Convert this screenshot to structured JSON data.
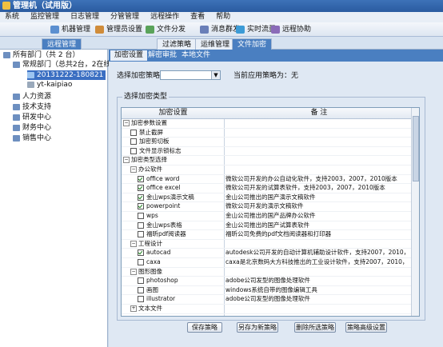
{
  "window": {
    "title": "管理机（试用版）"
  },
  "menu": [
    "系统",
    "监控管理",
    "日志管理",
    "分管管理",
    "远程操作",
    "查看",
    "帮助"
  ],
  "toolbar": [
    "机器管理",
    "管理员设置",
    "文件分发",
    "消息群发",
    "实时流量",
    "远程协助"
  ],
  "top_tabs": [
    "远程管理",
    "过滤策略",
    "运维管理",
    "文件加密"
  ],
  "tree": {
    "root": "所有部门（共 2 台）",
    "dept": "常规部门（总共2台，2在线）",
    "pcs": [
      "20131222-180821",
      "yt-kaipiao"
    ],
    "others": [
      "人力资源",
      "技术支持",
      "研发中心",
      "财务中心",
      "销售中心"
    ]
  },
  "sub_tabs": [
    "加密设置",
    "解密审批",
    "本地文件"
  ],
  "policy": {
    "select_label": "选择加密策略",
    "select_value": "",
    "current_label": "当前应用策略为：无"
  },
  "types_group": {
    "legend": "选择加密类型",
    "col_settings": "加密设置",
    "col_notes": "备 注",
    "rows": [
      {
        "indent": 0,
        "toggle": "−",
        "cb": null,
        "name": "加密参数设置",
        "note": ""
      },
      {
        "indent": 1,
        "toggle": null,
        "cb": false,
        "name": "禁止截屏",
        "note": ""
      },
      {
        "indent": 1,
        "toggle": null,
        "cb": false,
        "name": "加密剪切板",
        "note": ""
      },
      {
        "indent": 1,
        "toggle": null,
        "cb": false,
        "name": "文件显示锁标志",
        "note": ""
      },
      {
        "indent": 0,
        "toggle": "−",
        "cb": null,
        "name": "加密类型选择",
        "note": ""
      },
      {
        "indent": 1,
        "toggle": "−",
        "cb": null,
        "name": "办公软件",
        "note": ""
      },
      {
        "indent": 2,
        "toggle": null,
        "cb": true,
        "name": "office word",
        "note": "微软公司开发的办公自动化软件，支持2003，2007，2010版本"
      },
      {
        "indent": 2,
        "toggle": null,
        "cb": true,
        "name": "office excel",
        "note": "微软公司开发的试算表软件，支持2003，2007，2010版本"
      },
      {
        "indent": 2,
        "toggle": null,
        "cb": true,
        "name": "金山wps演示文稿",
        "note": "金山公司推出的国产演示文稿软件"
      },
      {
        "indent": 2,
        "toggle": null,
        "cb": true,
        "name": "powerpoint",
        "note": "微软公司开发的演示文稿软件"
      },
      {
        "indent": 2,
        "toggle": null,
        "cb": false,
        "name": "wps",
        "note": "金山公司推出的国产品牌办公软件"
      },
      {
        "indent": 2,
        "toggle": null,
        "cb": false,
        "name": "金山wps表格",
        "note": "金山公司推出的国产试算表软件"
      },
      {
        "indent": 2,
        "toggle": null,
        "cb": false,
        "name": "福昕pdf阅读器",
        "note": "福昕公司免费的pdf文档阅读器和打印器"
      },
      {
        "indent": 1,
        "toggle": "−",
        "cb": null,
        "name": "工程设计",
        "note": ""
      },
      {
        "indent": 2,
        "toggle": null,
        "cb": true,
        "name": "autocad",
        "note": "autodesk公司开发的自动计算机辅助设计软件，支持2007，2010，2012版本"
      },
      {
        "indent": 2,
        "toggle": null,
        "cb": false,
        "name": "caxa",
        "note": "caxa是北京数码大方科技推出的工业设计软件，支持2007，2010，2012版本"
      },
      {
        "indent": 1,
        "toggle": "−",
        "cb": null,
        "name": "图形图像",
        "note": ""
      },
      {
        "indent": 2,
        "toggle": null,
        "cb": false,
        "name": "photoshop",
        "note": "adobe公司发型的图像处理软件"
      },
      {
        "indent": 2,
        "toggle": null,
        "cb": false,
        "name": "画图",
        "note": "windows系统自带的图像编辑工具"
      },
      {
        "indent": 2,
        "toggle": null,
        "cb": false,
        "name": "illustrator",
        "note": "adobe公司发型的图像处理软件"
      },
      {
        "indent": 1,
        "toggle": "+",
        "cb": null,
        "name": "文本文件",
        "note": ""
      }
    ]
  },
  "buttons": {
    "save": "保存策略",
    "save_as": "另存为新策略",
    "delete": "删除所选策略",
    "advanced": "策略高级设置"
  },
  "colors": {
    "accent": "#4a7fc1",
    "title": "#2a5ba0"
  }
}
